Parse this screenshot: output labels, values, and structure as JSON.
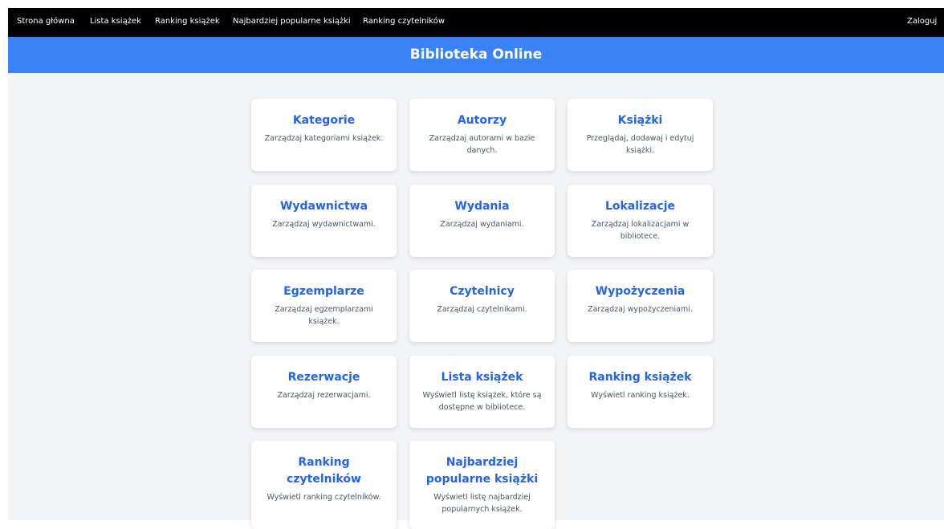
{
  "nav": {
    "links": [
      "Strona główna",
      "Lista książek",
      "Ranking książek",
      "Najbardziej popularne książki",
      "Ranking czytelników"
    ],
    "login": "Zaloguj"
  },
  "header": {
    "title": "Biblioteka Online"
  },
  "cards": [
    {
      "title": "Kategorie",
      "desc": "Zarządzaj kategoriami książek."
    },
    {
      "title": "Autorzy",
      "desc": "Zarządzaj autorami w bazie danych."
    },
    {
      "title": "Książki",
      "desc": "Przeglądaj, dodawaj i edytuj książki."
    },
    {
      "title": "Wydawnictwa",
      "desc": "Zarządzaj wydawnictwami."
    },
    {
      "title": "Wydania",
      "desc": "Zarządzaj wydaniami."
    },
    {
      "title": "Lokalizacje",
      "desc": "Zarządzaj lokalizacjami w bibliotece."
    },
    {
      "title": "Egzemplarze",
      "desc": "Zarządzaj egzemplarzami książek."
    },
    {
      "title": "Czytelnicy",
      "desc": "Zarządzaj czytelnikami."
    },
    {
      "title": "Wypożyczenia",
      "desc": "Zarządzaj wypożyczeniami."
    },
    {
      "title": "Rezerwacje",
      "desc": "Zarządzaj rezerwacjami."
    },
    {
      "title": "Lista książek",
      "desc": "Wyświetl listę książek, które są dostępne w bibliotece."
    },
    {
      "title": "Ranking książek",
      "desc": "Wyświetl ranking książek."
    },
    {
      "title": "Ranking czytelników",
      "desc": "Wyświetl ranking czytelników."
    },
    {
      "title": "Najbardziej popularne książki",
      "desc": "Wyświetl listę najbardziej popularnych książek."
    }
  ]
}
